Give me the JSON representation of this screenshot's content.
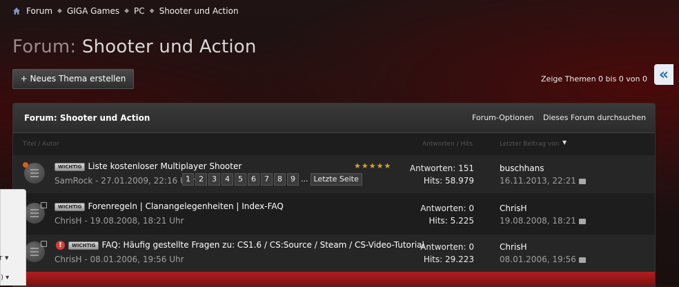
{
  "breadcrumbs": [
    "Forum",
    "GIGA Games",
    "PC",
    "Shooter und Action"
  ],
  "page_title": {
    "prefix": "Forum:",
    "name": "Shooter und Action"
  },
  "new_thread_label": "+ Neues Thema erstellen",
  "page_count": "Zeige Themen 0 bis 0 von 0",
  "side_tab_glyph": "«",
  "panel": {
    "title": "Forum: Shooter und Action",
    "options": [
      "Forum-Optionen",
      "Dieses Forum durchsuchen"
    ],
    "columns": {
      "title": "Titel / Autor",
      "replies": "Antworten / Hits",
      "last": "Letzter Beitrag von"
    }
  },
  "threads": [
    {
      "badge": "WICHTIG",
      "title": "Liste kostenloser Multiplayer Shooter",
      "meta": "SamRock - 27.01.2009, 22:16 Uhr",
      "pages": [
        "1",
        "2",
        "3",
        "4",
        "5",
        "6",
        "7",
        "8",
        "9"
      ],
      "pages_dots": "...",
      "last_page": "Letzte Seite",
      "stars": "★★★★★",
      "replies": "Antworten: 151",
      "hits": "Hits: 58.979",
      "last_user": "buschhans",
      "last_date": "16.11.2013, 22:21"
    },
    {
      "badge": "WICHTIG",
      "title": "Forenregeln | Clanangelegenheiten | Index-FAQ",
      "meta": "ChrisH - 19.08.2008, 18:21 Uhr",
      "replies": "Antworten: 0",
      "hits": "Hits: 5.225",
      "last_user": "ChrisH",
      "last_date": "19.08.2008, 18:21"
    },
    {
      "alert": "!",
      "badge": "WICHTIG",
      "title": "FAQ: Häufig gestellte Fragen zu: CS1.6 / CS:Source / Steam / CS-Video-Tutorial",
      "meta": "ChrisH - 08.01.2006, 19:56 Uhr",
      "replies": "Antworten: 0",
      "hits": "Hits: 29.223",
      "last_user": "ChrisH",
      "last_date": "08.01.2006, 19:56"
    }
  ],
  "ghost_panel": {
    "text1": "r ▾",
    "text2": ") ▾"
  }
}
